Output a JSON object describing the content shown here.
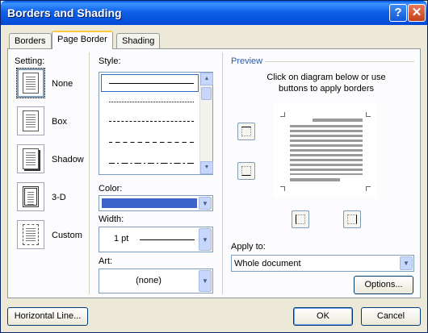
{
  "window": {
    "title": "Borders and Shading"
  },
  "tabs": [
    {
      "label": "Borders",
      "active": false
    },
    {
      "label": "Page Border",
      "active": true
    },
    {
      "label": "Shading",
      "active": false
    }
  ],
  "setting": {
    "label": "Setting:",
    "options": [
      {
        "label": "None",
        "selected": true
      },
      {
        "label": "Box",
        "selected": false
      },
      {
        "label": "Shadow",
        "selected": false
      },
      {
        "label": "3-D",
        "selected": false
      },
      {
        "label": "Custom",
        "selected": false
      }
    ]
  },
  "style": {
    "label": "Style:"
  },
  "color": {
    "label": "Color:",
    "value_color": "#3c64c8"
  },
  "width": {
    "label": "Width:",
    "value": "1 pt"
  },
  "art": {
    "label": "Art:",
    "value": "(none)"
  },
  "preview": {
    "label": "Preview",
    "instructions": "Click on diagram below or use buttons to apply borders"
  },
  "apply_to": {
    "label": "Apply to:",
    "value": "Whole document"
  },
  "buttons": {
    "options": "Options...",
    "horizontal_line": "Horizontal Line...",
    "ok": "OK",
    "cancel": "Cancel"
  },
  "icons": {
    "help": "?",
    "close": "✕"
  }
}
